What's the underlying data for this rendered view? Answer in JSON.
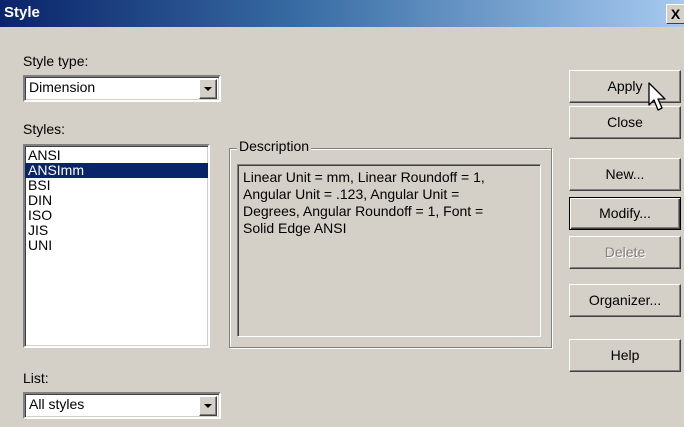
{
  "title": "Style",
  "close_glyph": "X",
  "style_type": {
    "label": "Style type:",
    "value": "Dimension"
  },
  "styles": {
    "label": "Styles:",
    "items": [
      "ANSI",
      "ANSImm",
      "BSI",
      "DIN",
      "ISO",
      "JIS",
      "UNI"
    ],
    "selected": "ANSImm"
  },
  "description": {
    "title": "Description",
    "lines": [
      "Linear Unit = mm, Linear Roundoff = 1,",
      "Angular Unit = .123, Angular Unit =",
      "Degrees, Angular Roundoff = 1, Font =",
      "Solid Edge ANSI"
    ]
  },
  "list": {
    "label": "List:",
    "value": "All styles"
  },
  "buttons": {
    "apply": "Apply",
    "close": "Close",
    "new": "New...",
    "modify": "Modify...",
    "delete": "Delete",
    "organizer": "Organizer...",
    "help": "Help"
  },
  "colors": {
    "title_bar": "#0a246a",
    "selection": "#0a246a",
    "face": "#d4d0c8"
  },
  "icons": {
    "dropdown": "chevron-down-icon",
    "cursor": "mouse-pointer-icon",
    "close": "close-icon"
  }
}
